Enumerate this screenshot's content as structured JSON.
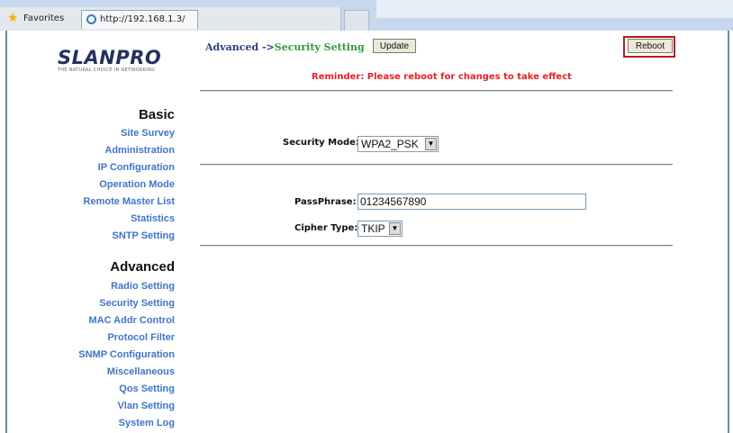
{
  "browser": {
    "favorites_label": "Favorites",
    "tab_url": "http://192.168.1.3/"
  },
  "logo": {
    "name": "LANPRO",
    "tagline": "THE NATURAL CHOICE IN NETWORKING"
  },
  "nav": {
    "basic_title": "Basic",
    "basic_items": [
      "Site Survey",
      "Administration",
      "IP Configuration",
      "Operation Mode",
      "Remote Master List",
      "Statistics",
      "SNTP Setting"
    ],
    "advanced_title": "Advanced",
    "advanced_items": [
      "Radio Setting",
      "Security Setting",
      "MAC Addr Control",
      "Protocol Filter",
      "SNMP Configuration",
      "Miscellaneous",
      "Qos Setting",
      "Vlan Setting",
      "System Log"
    ]
  },
  "header": {
    "section": "Advanced ->",
    "page": "Security Setting",
    "update_label": "Update",
    "reboot_label": "Reboot"
  },
  "reminder": "Reminder: Please reboot for changes to take effect",
  "form": {
    "security_mode_label": "Security Mode:",
    "security_mode_value": "WPA2_PSK",
    "passphrase_label": "PassPhrase:",
    "passphrase_value": "01234567890",
    "cipher_label": "Cipher Type:",
    "cipher_value": "TKIP"
  },
  "colors": {
    "nav_link": "#3f75c6",
    "reminder": "#e32222",
    "reboot_highlight": "#b0201e",
    "page_title": "#2f9a3a"
  }
}
